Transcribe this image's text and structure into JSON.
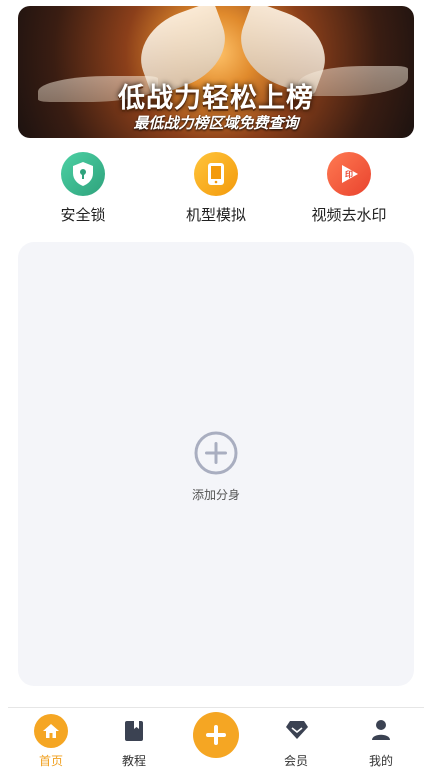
{
  "banner": {
    "title": "低战力轻松上榜",
    "subtitle": "最低战力榜区域免费查询"
  },
  "tools": [
    {
      "label": "安全锁",
      "icon": "shield-lock-icon",
      "color": "#34b58f"
    },
    {
      "label": "机型模拟",
      "icon": "tablet-icon",
      "color": "#f4a516"
    },
    {
      "label": "视频去水印",
      "icon": "video-watermark-icon",
      "color": "#f05a3e"
    }
  ],
  "main": {
    "add_label": "添加分身"
  },
  "tabbar": {
    "items": [
      {
        "label": "首页",
        "icon": "home-icon",
        "active": true
      },
      {
        "label": "教程",
        "icon": "book-icon",
        "active": false
      },
      {
        "label": "",
        "icon": "plus-icon",
        "active": false
      },
      {
        "label": "会员",
        "icon": "diamond-icon",
        "active": false
      },
      {
        "label": "我的",
        "icon": "person-icon",
        "active": false
      }
    ]
  },
  "colors": {
    "accent": "#f5a623",
    "card_bg": "#f4f5f9",
    "add_icon": "#a9aec0"
  }
}
